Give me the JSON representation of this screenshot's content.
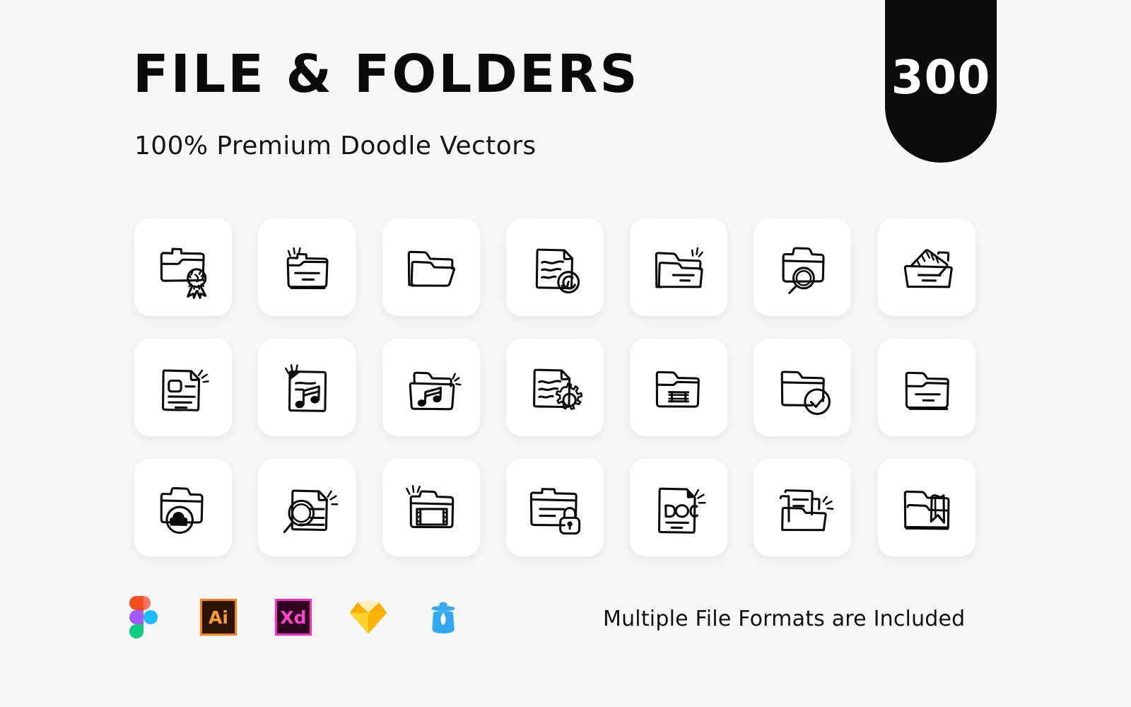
{
  "header": {
    "title": "FILE & FOLDERS",
    "subtitle": "100% Premium Doodle Vectors",
    "badge_count": "300"
  },
  "colors": {
    "page_background": "#f7f7f7",
    "card_background": "#ffffff",
    "ink": "#0a0a0a",
    "badge_background": "#0b0b0b",
    "badge_text": "#ffffff"
  },
  "grid": {
    "columns": 7,
    "rows": 3,
    "icons": [
      {
        "name": "folder-award-icon",
        "label": "Folder with award ribbon"
      },
      {
        "name": "folder-lines-icon",
        "label": "Folder with document lines"
      },
      {
        "name": "folder-open-icon",
        "label": "Open folder"
      },
      {
        "name": "file-history-icon",
        "label": "Document with restore history"
      },
      {
        "name": "folder-open-lines-icon",
        "label": "Open folder with lines"
      },
      {
        "name": "folder-search-icon",
        "label": "Folder with magnifier"
      },
      {
        "name": "folder-documents-icon",
        "label": "Folder with stacked documents"
      },
      {
        "name": "file-article-icon",
        "label": "Document with image and text"
      },
      {
        "name": "file-music-icon",
        "label": "Music file"
      },
      {
        "name": "folder-music-icon",
        "label": "Music folder"
      },
      {
        "name": "file-settings-icon",
        "label": "Document with gear"
      },
      {
        "name": "folder-film-icon",
        "label": "Folder with film strip"
      },
      {
        "name": "folder-check-icon",
        "label": "Folder with checkmark"
      },
      {
        "name": "folder-lines-plain-icon",
        "label": "Folder with lines"
      },
      {
        "name": "folder-cloud-icon",
        "label": "Folder with cloud"
      },
      {
        "name": "file-search-icon",
        "label": "Document with magnifier"
      },
      {
        "name": "folder-video-icon",
        "label": "Folder with video strip"
      },
      {
        "name": "folder-lock-icon",
        "label": "Folder with padlock"
      },
      {
        "name": "file-doc-icon",
        "label": "DOC document"
      },
      {
        "name": "folder-open-file-icon",
        "label": "Open folder with document"
      },
      {
        "name": "folder-bookmark-icon",
        "label": "Folder with bookmark"
      }
    ]
  },
  "footer": {
    "note": "Multiple File Formats are Included",
    "formats": [
      {
        "name": "figma-logo",
        "label": "Figma"
      },
      {
        "name": "illustrator-logo",
        "label": "Ai"
      },
      {
        "name": "adobe-xd-logo",
        "label": "Xd"
      },
      {
        "name": "sketch-logo",
        "label": "Sketch"
      },
      {
        "name": "jar-logo",
        "label": "Jar"
      }
    ]
  }
}
